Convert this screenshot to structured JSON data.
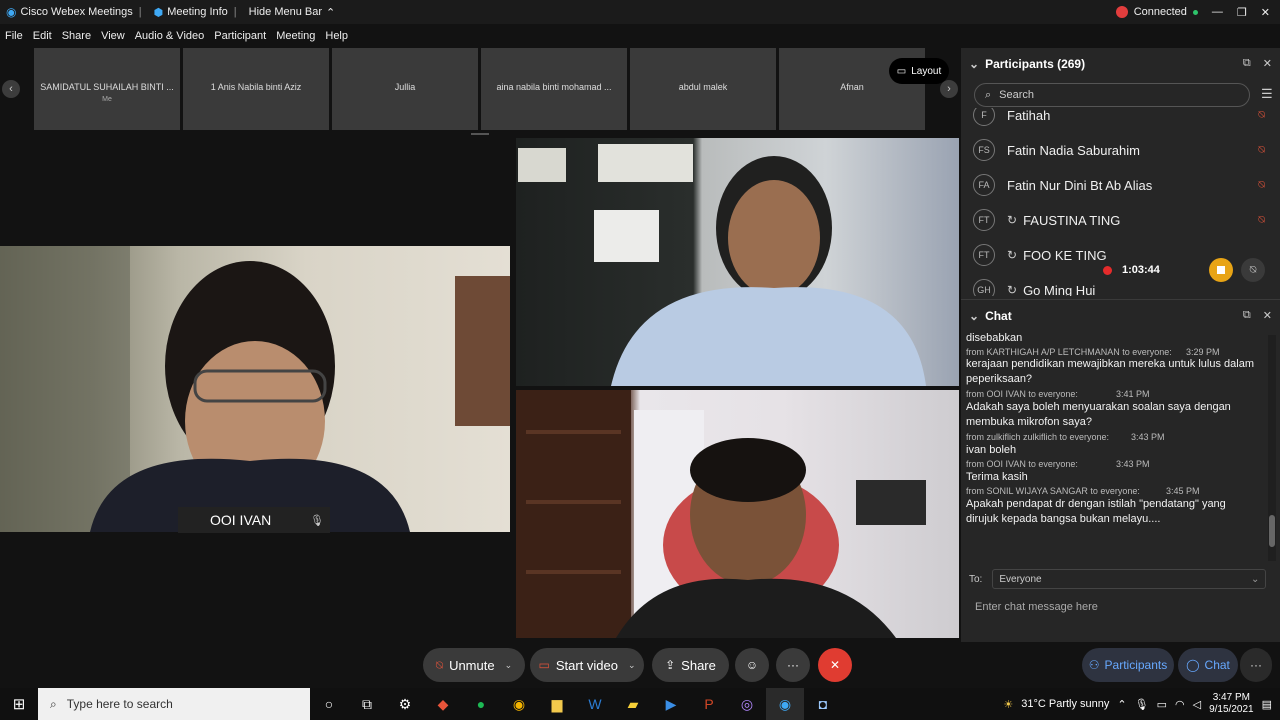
{
  "titlebar": {
    "app_name": "Cisco Webex Meetings",
    "meeting_info": "Meeting Info",
    "hide_menu": "Hide Menu Bar",
    "status": "Connected"
  },
  "menu": [
    "File",
    "Edit",
    "Share",
    "View",
    "Audio & Video",
    "Participant",
    "Meeting",
    "Help"
  ],
  "thumbnails": [
    {
      "name": "SAMIDATUL SUHAILAH BINTI ...",
      "sub": "Me"
    },
    {
      "name": "1 Anis Nabila binti Aziz",
      "sub": ""
    },
    {
      "name": "Jullia",
      "sub": ""
    },
    {
      "name": "aina nabila binti mohamad ...",
      "sub": ""
    },
    {
      "name": "abdul malek",
      "sub": ""
    },
    {
      "name": "Afnan",
      "sub": ""
    }
  ],
  "layout_label": "Layout",
  "active_speaker": "OOI IVAN",
  "participants": {
    "title": "Participants (269)",
    "search_placeholder": "Search",
    "list": [
      {
        "initials": "F",
        "name": "Fatihah"
      },
      {
        "initials": "FS",
        "name": "Fatin Nadia Saburahim"
      },
      {
        "initials": "FA",
        "name": "Fatin Nur Dini Bt Ab Alias"
      },
      {
        "initials": "FT",
        "name": "FAUSTINA TING"
      },
      {
        "initials": "FT",
        "name": "FOO KE TING"
      },
      {
        "initials": "GH",
        "name": "Go Ming Hui"
      }
    ]
  },
  "recording": {
    "time": "1:03:44"
  },
  "chat": {
    "title": "Chat",
    "messages": [
      {
        "kind": "text",
        "text": "disebabkan"
      },
      {
        "kind": "from",
        "text": "from KARTHIGAH A/P LETCHMANAN to everyone:",
        "time": "3:29 PM"
      },
      {
        "kind": "text",
        "text": "kerajaan pendidikan mewajibkan mereka untuk lulus dalam"
      },
      {
        "kind": "text",
        "text": "peperiksaan?"
      },
      {
        "kind": "from",
        "text": "from OOI IVAN to everyone:",
        "time": "3:41 PM"
      },
      {
        "kind": "text",
        "text": "Adakah saya boleh menyuarakan soalan saya dengan"
      },
      {
        "kind": "text",
        "text": "membuka mikrofon saya?"
      },
      {
        "kind": "from",
        "text": "from zulkiflich zulkiflich to everyone:",
        "time": "3:43 PM"
      },
      {
        "kind": "text",
        "text": "ivan boleh"
      },
      {
        "kind": "from",
        "text": "from OOI IVAN to everyone:",
        "time": "3:43 PM"
      },
      {
        "kind": "text",
        "text": "Terima kasih"
      },
      {
        "kind": "from",
        "text": "from SONIL WIJAYA SANGAR to everyone:",
        "time": "3:45 PM"
      },
      {
        "kind": "text",
        "text": "Apakah pendapat dr dengan istilah \"pendatang\" yang"
      },
      {
        "kind": "text",
        "text": "dirujuk kepada bangsa bukan melayu...."
      }
    ],
    "to_label": "To:",
    "to_value": "Everyone",
    "input_placeholder": "Enter chat message here"
  },
  "controls": {
    "unmute": "Unmute",
    "start_video": "Start video",
    "share": "Share",
    "participants": "Participants",
    "chat": "Chat"
  },
  "taskbar": {
    "search_placeholder": "Type here to search",
    "weather": "31°C  Partly sunny",
    "time": "3:47 PM",
    "date": "9/15/2021"
  },
  "colors": {
    "accent": "#67a9ff",
    "leave": "#e03c31",
    "recording": "#e52b2b",
    "stop": "#e8a415"
  }
}
